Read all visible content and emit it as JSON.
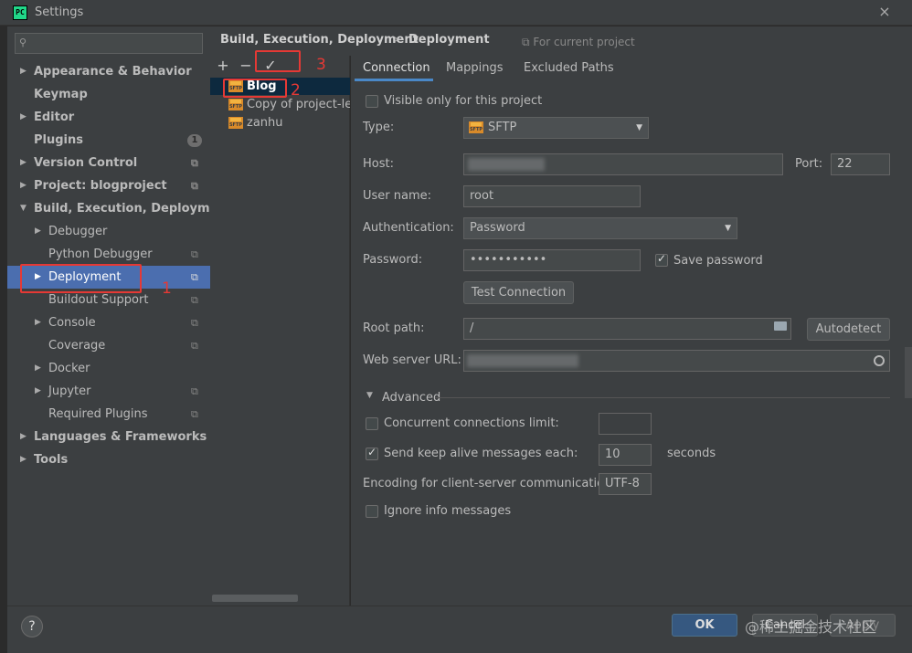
{
  "window": {
    "title": "Settings",
    "app_icon": "PC",
    "close": "×"
  },
  "sidebar": {
    "search_placeholder": "",
    "items": [
      {
        "label": "Appearance & Behavior"
      },
      {
        "label": "Keymap"
      },
      {
        "label": "Editor"
      },
      {
        "label": "Plugins",
        "badge": "1"
      },
      {
        "label": "Version Control"
      },
      {
        "label": "Project: blogproject"
      },
      {
        "label": "Build, Execution, Deployment"
      },
      {
        "label": "Debugger"
      },
      {
        "label": "Python Debugger"
      },
      {
        "label": "Deployment"
      },
      {
        "label": "Buildout Support"
      },
      {
        "label": "Console"
      },
      {
        "label": "Coverage"
      },
      {
        "label": "Docker"
      },
      {
        "label": "Jupyter"
      },
      {
        "label": "Required Plugins"
      },
      {
        "label": "Languages & Frameworks"
      },
      {
        "label": "Tools"
      }
    ]
  },
  "breadcrumb": {
    "parent": "Build, Execution, Deployment",
    "separator": "›",
    "current": "Deployment",
    "scope": "For current project"
  },
  "toolbar": {
    "add": "+",
    "remove": "−",
    "default": "✓"
  },
  "servers": [
    {
      "name": "Blog"
    },
    {
      "name": "Copy of project-level server 'Blog'"
    },
    {
      "name": "zanhu"
    }
  ],
  "tabs": [
    "Connection",
    "Mappings",
    "Excluded Paths"
  ],
  "connection": {
    "visible_only": "Visible only for this project",
    "type_label": "Type:",
    "type_value": "SFTP",
    "host_label": "Host:",
    "port_label": "Port:",
    "port_value": "22",
    "username_label": "User name:",
    "username_value": "root",
    "auth_label": "Authentication:",
    "auth_value": "Password",
    "password_label": "Password:",
    "password_value": "•••••••••••",
    "save_password": "Save password",
    "test_connection": "Test Connection",
    "root_path_label": "Root path:",
    "root_path_value": "/",
    "autodetect": "Autodetect",
    "web_url_label": "Web server URL:"
  },
  "advanced": {
    "title": "Advanced",
    "concurrent": "Concurrent connections limit:",
    "keep_alive": "Send keep alive messages each:",
    "keep_alive_value": "10",
    "seconds": "seconds",
    "encoding_label": "Encoding for client-server communication:",
    "encoding_value": "UTF-8",
    "ignore_info": "Ignore info messages"
  },
  "footer": {
    "help": "?",
    "ok": "OK",
    "cancel": "Cancel",
    "apply": "Apply",
    "watermark": "@稀土掘金技术社区"
  },
  "annotations": {
    "n1": "1",
    "n2": "2",
    "n3": "3"
  }
}
